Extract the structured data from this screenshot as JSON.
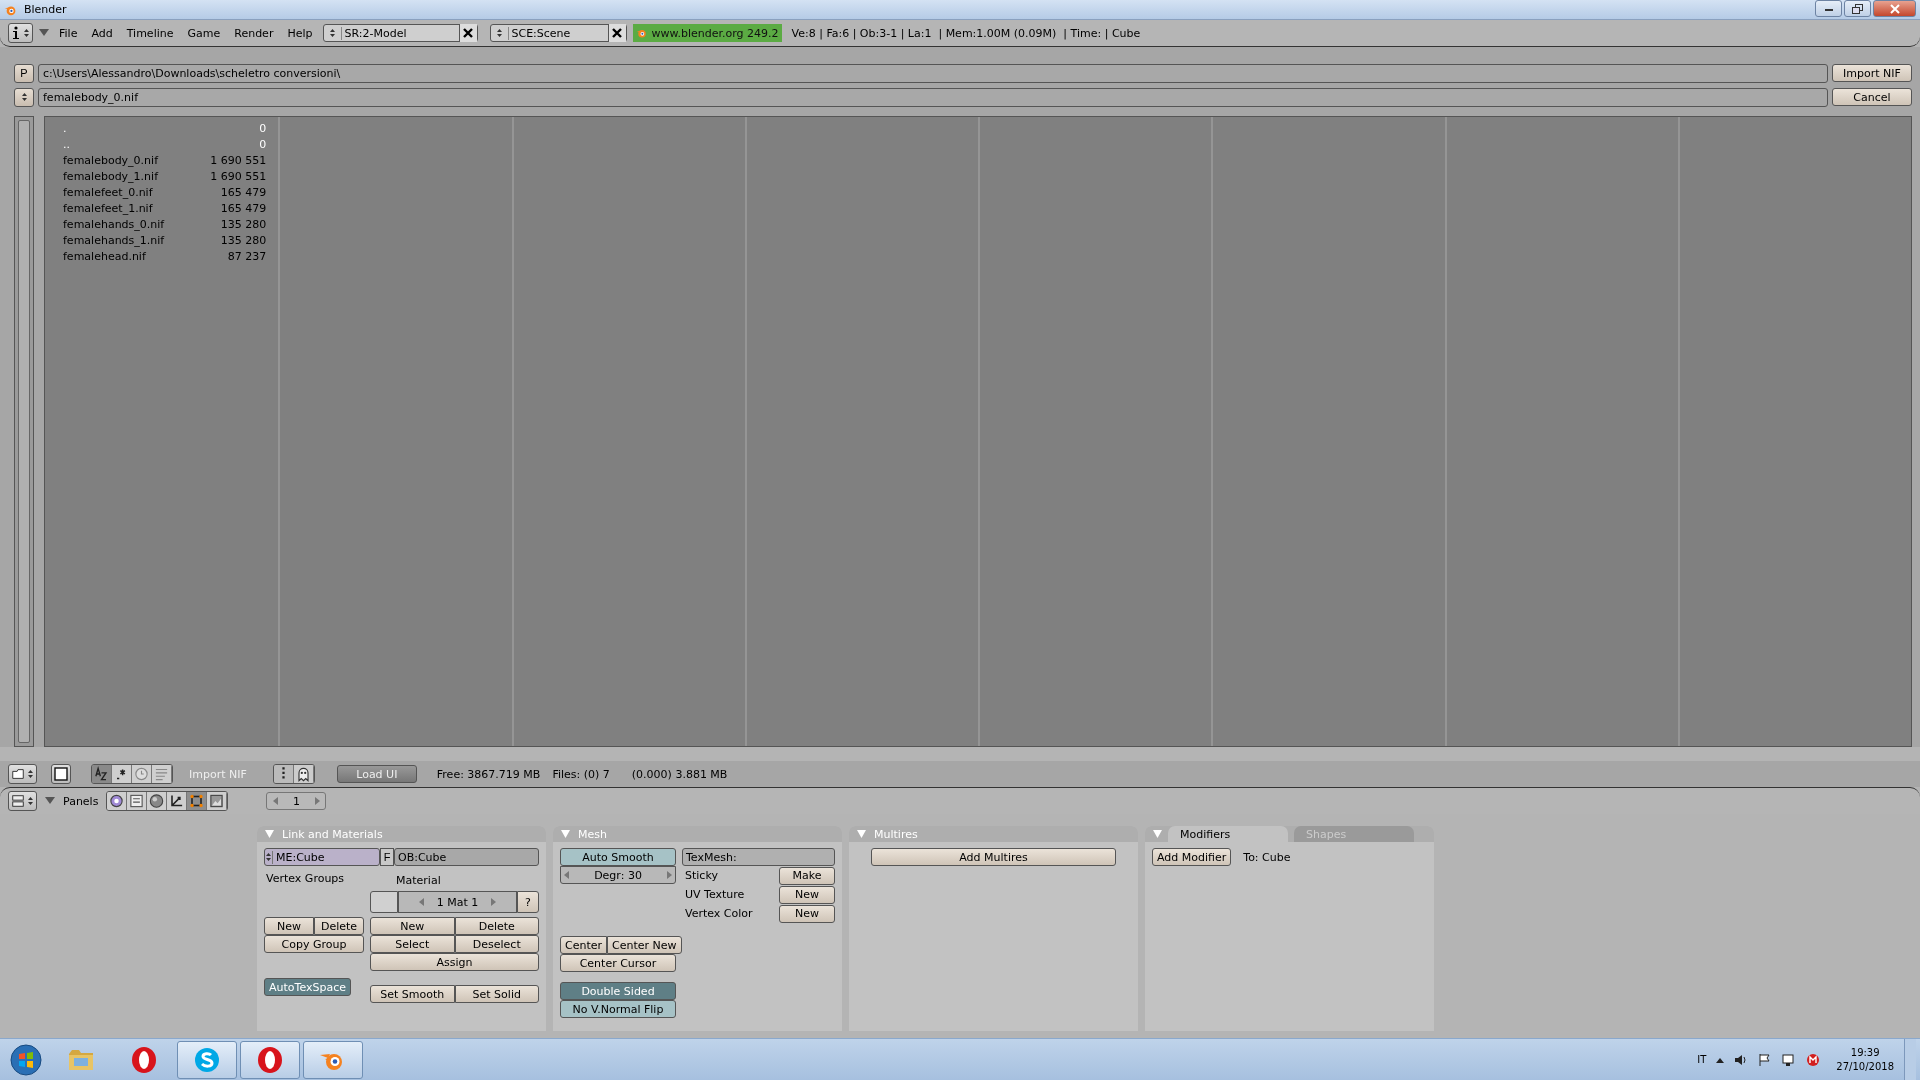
{
  "window": {
    "title": "Blender"
  },
  "header": {
    "menus": [
      "File",
      "Add",
      "Timeline",
      "Game",
      "Render",
      "Help"
    ],
    "screen": "SR:2-Model",
    "scene": "SCE:Scene",
    "version": "www.blender.org 249.2",
    "stats": "Ve:8 | Fa:6 | Ob:3-1 | La:1  | Mem:1.00M (0.09M)  | Time: | Cube"
  },
  "file_browser": {
    "path_button": "P",
    "path": "c:\\Users\\Alessandro\\Downloads\\scheletro conversioni\\",
    "filename": "femalebody_0.nif",
    "import_button": "Import NIF",
    "cancel_button": "Cancel",
    "files": [
      {
        "name": ".",
        "size": "0",
        "kind": "dir"
      },
      {
        "name": "..",
        "size": "0",
        "kind": "dir"
      },
      {
        "name": "femalebody_0.nif",
        "size": "1 690 551",
        "kind": "file"
      },
      {
        "name": "femalebody_1.nif",
        "size": "1 690 551",
        "kind": "file"
      },
      {
        "name": "femalefeet_0.nif",
        "size": "165 479",
        "kind": "file"
      },
      {
        "name": "femalefeet_1.nif",
        "size": "165 479",
        "kind": "file"
      },
      {
        "name": "femalehands_0.nif",
        "size": "135 280",
        "kind": "file"
      },
      {
        "name": "femalehands_1.nif",
        "size": "135 280",
        "kind": "file"
      },
      {
        "name": "femalehead.nif",
        "size": "87 237",
        "kind": "file"
      }
    ],
    "sort_modes": [
      {
        "kind": "alpha",
        "selected": true
      },
      {
        "kind": "extension",
        "selected": false
      },
      {
        "kind": "time",
        "selected": false
      },
      {
        "kind": "size",
        "selected": false
      }
    ],
    "footer": {
      "title": "Import NIF",
      "load_ui": "Load UI",
      "free": "Free: 3867.719 MB",
      "files": "Files: (0) 7",
      "size": "(0.000) 3.881 MB"
    }
  },
  "buttons_header": {
    "panels_label": "Panels",
    "page": "1",
    "contexts": [
      {
        "kind": "logic",
        "selected": false
      },
      {
        "kind": "script",
        "selected": false
      },
      {
        "kind": "shading",
        "selected": false
      },
      {
        "kind": "object",
        "selected": false
      },
      {
        "kind": "editing",
        "selected": true
      },
      {
        "kind": "scene",
        "selected": false
      }
    ]
  },
  "panels": [
    {
      "kind": "link_materials",
      "title": "Link and Materials",
      "mesh_field": "ME:Cube",
      "fake_user": "F",
      "object_field": "OB:Cube",
      "vertex_groups_label": "Vertex Groups",
      "vg_new": "New",
      "vg_delete": "Delete",
      "copy_group": "Copy Group",
      "autotexspace": {
        "label": "AutoTexSpace",
        "on": true
      },
      "material_label": "Material",
      "material_slot": "1 Mat 1",
      "material_help": "?",
      "mat_new": "New",
      "mat_delete": "Delete",
      "select": "Select",
      "deselect": "Deselect",
      "assign": "Assign",
      "set_smooth": "Set Smooth",
      "set_solid": "Set Solid"
    },
    {
      "kind": "mesh",
      "title": "Mesh",
      "auto_smooth": {
        "label": "Auto Smooth",
        "on": false
      },
      "degree": "Degr: 30",
      "center": "Center",
      "center_new": "Center New",
      "center_cursor": "Center Cursor",
      "double_sided": {
        "label": "Double Sided",
        "on": true
      },
      "no_normal_flip": {
        "label": "No V.Normal Flip",
        "on": false
      },
      "texmesh": "TexMesh:",
      "rows": [
        {
          "label": "Sticky",
          "button": "Make"
        },
        {
          "label": "UV Texture",
          "button": "New"
        },
        {
          "label": "Vertex Color",
          "button": "New"
        }
      ]
    },
    {
      "kind": "multires",
      "title": "Multires",
      "button": "Add Multires"
    },
    {
      "kind": "modifiers",
      "tabs": [
        {
          "label": "Modifiers",
          "selected": true
        },
        {
          "label": "Shapes",
          "selected": false
        }
      ],
      "button": "Add Modifier",
      "target": "To: Cube"
    }
  ],
  "taskbar": {
    "apps": [
      {
        "kind": "explorer",
        "running": false
      },
      {
        "kind": "opera",
        "running": false
      },
      {
        "kind": "skype",
        "running": true
      },
      {
        "kind": "opera",
        "running": true
      },
      {
        "kind": "blender",
        "running": true
      }
    ],
    "language": "IT",
    "time": "19:39",
    "date": "27/10/2018"
  }
}
